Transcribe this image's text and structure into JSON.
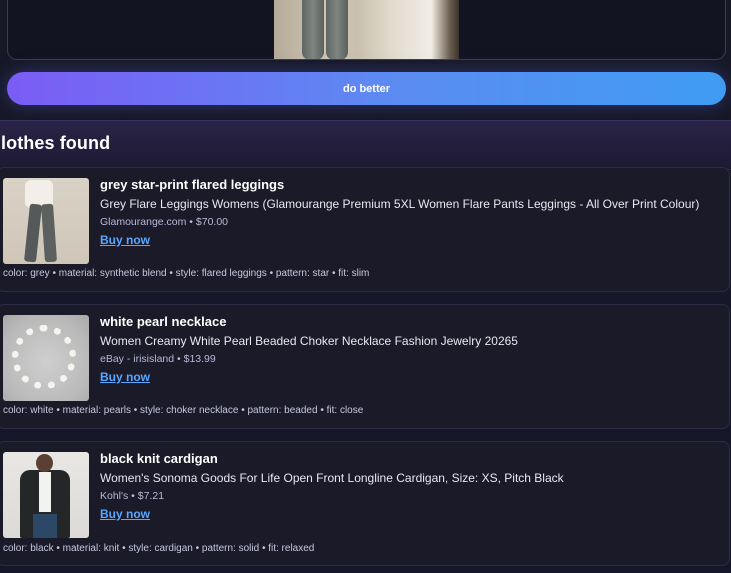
{
  "cta": {
    "label": "do better"
  },
  "results": {
    "heading": "lothes found"
  },
  "items": [
    {
      "title": "grey star-print flared leggings",
      "product": "Grey Flare Leggings Womens (Glamourange Premium 5XL Women Flare Pants Leggings - All Over Print Colour)",
      "source": "Glamourange.com • $70.00",
      "buy": "Buy now",
      "attributes": "color: grey • material: synthetic blend • style: flared leggings • pattern: star • fit: slim"
    },
    {
      "title": "white pearl necklace",
      "product": "Women Creamy White Pearl Beaded Choker Necklace Fashion Jewelry 20265",
      "source": "eBay - irisisland • $13.99",
      "buy": "Buy now",
      "attributes": "color: white • material: pearls • style: choker necklace • pattern: beaded • fit: close"
    },
    {
      "title": "black knit cardigan",
      "product": "Women's Sonoma Goods For Life Open Front Longline Cardigan, Size: XS, Pitch Black",
      "source": "Kohl's • $7.21",
      "buy": "Buy now",
      "attributes": "color: black • material: knit • style: cardigan • pattern: solid • fit: relaxed"
    }
  ],
  "colors": {
    "accent_start": "#7b5cf5",
    "accent_end": "#3f9cf3",
    "link": "#5aa7ff"
  }
}
